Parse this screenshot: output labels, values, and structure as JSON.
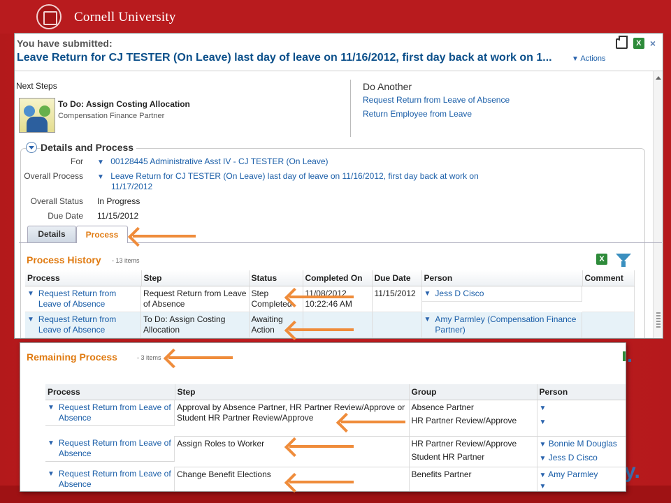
{
  "branding": {
    "name": "Cornell University"
  },
  "window": {
    "submitted_label": "You have submitted:",
    "title": "Leave Return for CJ TESTER (On Leave) last day of leave on 11/16/2012, first day back at work on 1...",
    "actions_label": "Actions",
    "excel_glyph": "X",
    "close_glyph": "×"
  },
  "next_steps": {
    "label": "Next Steps",
    "todo_title": "To Do: Assign Costing Allocation",
    "todo_role": "Compensation Finance Partner"
  },
  "do_another": {
    "title": "Do Another",
    "links": [
      "Request Return from Leave of Absence",
      "Return Employee from Leave"
    ]
  },
  "details": {
    "section_title": "Details and Process",
    "for_label": "For",
    "for_value": "00128445 Administrative Asst IV - CJ TESTER (On Leave)",
    "overall_process_label": "Overall Process",
    "overall_process_value_1": "Leave Return for CJ TESTER (On Leave) last day of leave on 11/16/2012, first day back at work on",
    "overall_process_value_2": "11/17/2012",
    "overall_status_label": "Overall Status",
    "overall_status_value": "In Progress",
    "due_date_label": "Due Date",
    "due_date_value": "11/15/2012"
  },
  "tabs": {
    "details": "Details",
    "process": "Process"
  },
  "process_history": {
    "title": "Process History",
    "count": "- 13 items",
    "columns": [
      "Process",
      "Step",
      "Status",
      "Completed On",
      "Due Date",
      "Person",
      "Comment"
    ],
    "rows": [
      {
        "process": "Request Return from Leave of Absence",
        "step": "Request Return from Leave of Absence",
        "status": "Step Completed",
        "completed_1": "11/08/2012",
        "completed_2": "10:22:46 AM",
        "due": "11/15/2012",
        "person": "Jess D Cisco",
        "comment": ""
      },
      {
        "process": "Request Return from Leave of Absence",
        "step": "To Do: Assign Costing Allocation",
        "status": "Awaiting Action",
        "completed_1": "",
        "completed_2": "",
        "due": "",
        "person": "Amy Parmley (Compensation Finance Partner)",
        "comment": ""
      }
    ]
  },
  "remaining_process": {
    "title": "Remaining Process",
    "count": "- 3 items",
    "columns": [
      "Process",
      "Step",
      "Group",
      "Person"
    ],
    "rows": [
      {
        "process": "Request Return from Leave of Absence",
        "step": "Approval by Absence Partner, HR Partner Review/Approve or Student HR Partner Review/Approve",
        "group_1": "Absence Partner",
        "group_2": "HR Partner Review/Approve",
        "person_1": "",
        "person_2": ""
      },
      {
        "process": "Request Return from Leave of Absence",
        "step": "Assign Roles to Worker",
        "group_1": "HR Partner Review/Approve",
        "group_2": "Student HR Partner",
        "person_1": "Bonnie M Douglas",
        "person_2": "Jess D Cisco"
      },
      {
        "process": "Request Return from Leave of Absence",
        "step": "Change Benefit Elections",
        "group_1": "Benefits Partner",
        "group_2": "",
        "person_1": "Amy Parmley",
        "person_2": ""
      }
    ]
  },
  "colors": {
    "brand_red": "#b81b1e",
    "link_blue": "#1a5ea8",
    "accent_orange": "#e07b12",
    "arrow_orange": "#ef8c3b"
  },
  "icons": [
    "cornell-seal-icon",
    "print-icon",
    "excel-icon",
    "close-icon",
    "dropdown-caret-icon",
    "people-task-icon",
    "collapse-toggle-icon",
    "filter-icon"
  ],
  "background_fragments": {
    "letter_1": ".",
    "letter_2": "y."
  }
}
